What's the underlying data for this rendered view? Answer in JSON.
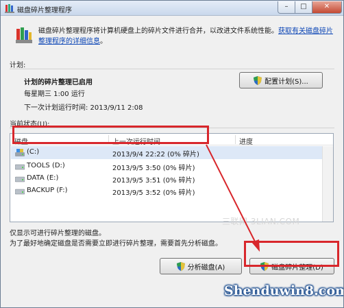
{
  "window": {
    "title": "磁盘碎片整理程序",
    "controls": {
      "minimize": "–",
      "maximize": "□",
      "close": "✕"
    }
  },
  "intro": {
    "text": "磁盘碎片整理程序将计算机硬盘上的碎片文件进行合并，以改进文件系统性能。",
    "link": "获取有关磁盘碎片整理程序的详细信息",
    "link_tail": "。"
  },
  "schedule": {
    "section_label": "计划:",
    "status": "计划的碎片整理已启用",
    "frequency": "每星期三 1:00 运行",
    "next_run": "下一次计划运行时间: 2013/9/11 2:08",
    "configure_button": "配置计划(S)..."
  },
  "status_section": {
    "label": "当前状态(U):",
    "columns": [
      "磁盘",
      "上一次运行时间",
      "进度"
    ],
    "rows": [
      {
        "disk": "(C:)",
        "last_run": "2013/9/4 22:22 (0% 碎片)",
        "progress": "",
        "icon": "system-drive-icon",
        "selected": true
      },
      {
        "disk": "TOOLS (D:)",
        "last_run": "2013/9/5 3:50 (0% 碎片)",
        "progress": "",
        "icon": "hard-drive-icon",
        "selected": false
      },
      {
        "disk": "DATA (E:)",
        "last_run": "2013/9/5 3:51 (0% 碎片)",
        "progress": "",
        "icon": "hard-drive-icon",
        "selected": false
      },
      {
        "disk": "BACKUP (F:)",
        "last_run": "2013/9/5 3:52 (0% 碎片)",
        "progress": "",
        "icon": "hard-drive-icon",
        "selected": false
      }
    ]
  },
  "footer": {
    "note1": "仅显示可进行碎片整理的磁盘。",
    "note2": "为了最好地确定磁盘是否需要立即进行碎片整理，需要首先分析磁盘。",
    "analyze_button": "分析磁盘(A)",
    "defrag_button": "磁盘碎片整理(D)"
  },
  "watermarks": {
    "center": "三联网 3LIAN.COM",
    "brand": "Shenduwin8.com"
  },
  "colors": {
    "annotation_red": "#d8262b",
    "link_blue": "#0a44b5",
    "selection": "#dde8f7"
  }
}
